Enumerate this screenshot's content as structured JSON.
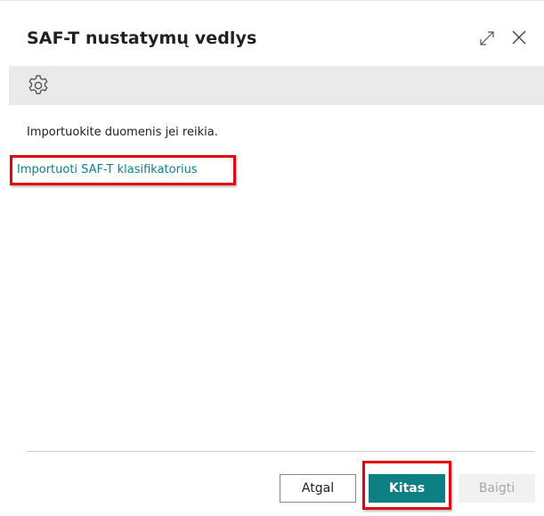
{
  "dialog": {
    "title": "SAF-T nustatymų vedlys"
  },
  "icons": {
    "expand": "expand-icon",
    "close": "close-icon",
    "settings": "gear-icon"
  },
  "content": {
    "instruction": "Importuokite duomenis jei reikia.",
    "import_link": "Importuoti SAF-T klasifikatorius"
  },
  "footer": {
    "back_label": "Atgal",
    "next_label": "Kitas",
    "finish_label": "Baigti"
  },
  "colors": {
    "accent": "#0e7f82",
    "link": "#0e7f8a",
    "highlight": "#e4000f"
  }
}
